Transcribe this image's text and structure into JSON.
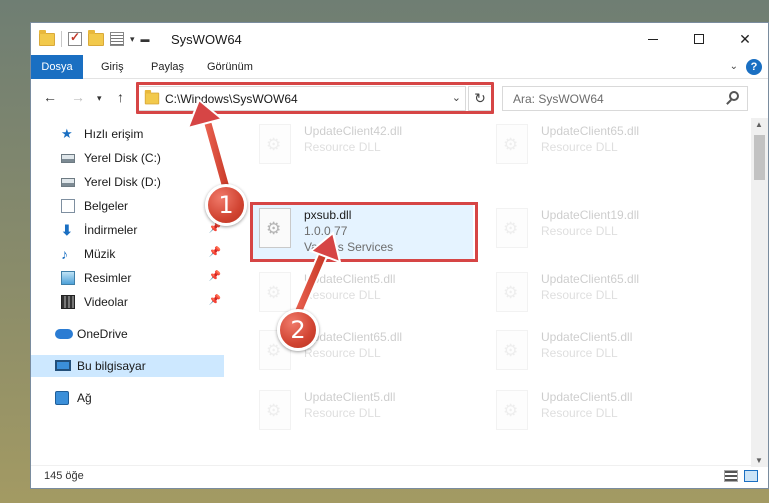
{
  "window": {
    "title": "SysWOW64",
    "minimize_glyph": "",
    "close_glyph": "✕"
  },
  "ribbon": {
    "tabs": [
      "Dosya",
      "Giriş",
      "Paylaş",
      "Görünüm"
    ],
    "help_label": "?"
  },
  "address": {
    "path": "C:\\Windows\\SysWOW64",
    "search_placeholder": "Ara: SysWOW64"
  },
  "sidebar": {
    "items": [
      {
        "label": "Hızlı erişim",
        "icon": "star-icon",
        "pinned": false
      },
      {
        "label": "Yerel Disk (C:)",
        "icon": "drive-icon",
        "pinned": false
      },
      {
        "label": "Yerel Disk (D:)",
        "icon": "drive-icon",
        "pinned": false
      },
      {
        "label": "Belgeler",
        "icon": "document-icon",
        "pinned": true
      },
      {
        "label": "İndirmeler",
        "icon": "download-icon",
        "pinned": true
      },
      {
        "label": "Müzik",
        "icon": "music-icon",
        "pinned": true
      },
      {
        "label": "Resimler",
        "icon": "pictures-icon",
        "pinned": true
      },
      {
        "label": "Videolar",
        "icon": "video-icon",
        "pinned": true
      },
      {
        "label": "OneDrive",
        "icon": "cloud-icon",
        "pinned": false
      },
      {
        "label": "Bu bilgisayar",
        "icon": "computer-icon",
        "pinned": false,
        "selected": true
      },
      {
        "label": "Ağ",
        "icon": "network-icon",
        "pinned": false
      }
    ]
  },
  "files": {
    "left_column": [
      {
        "name": "UpdateClient42.dll",
        "type": "Resource DLL"
      },
      {
        "name": "pxsub.dll",
        "version": "1.0.0.77",
        "company": "Various Services",
        "highlighted": true
      },
      {
        "name": "UpdateClient5.dll",
        "type": "Resource DLL"
      },
      {
        "name": "UpdateClient65.dll",
        "type": "Resource DLL"
      },
      {
        "name": "UpdateClient5.dll",
        "type": "Resource DLL"
      }
    ],
    "right_column": [
      {
        "name": "UpdateClient65.dll",
        "type": "Resource DLL"
      },
      {
        "name": "UpdateClient19.dll",
        "type": "Resource DLL"
      },
      {
        "name": "UpdateClient65.dll",
        "type": "Resource DLL"
      },
      {
        "name": "UpdateClient5.dll",
        "type": "Resource DLL"
      },
      {
        "name": "UpdateClient5.dll",
        "type": "Resource DLL"
      }
    ]
  },
  "status": {
    "item_count": "145 öğe"
  },
  "annotations": {
    "step1": "1",
    "step2": "2",
    "color": "#d64545"
  }
}
